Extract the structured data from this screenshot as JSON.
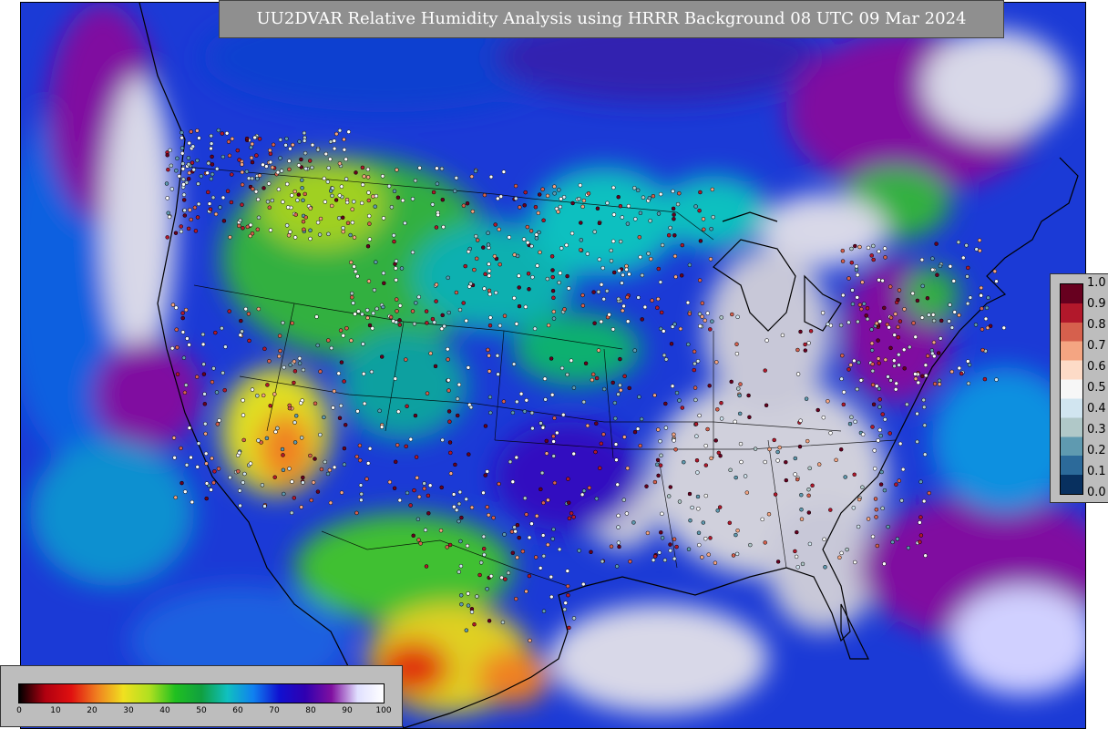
{
  "title": "UU2DVAR Relative Humidity Analysis using HRRR Background 08 UTC 09 Mar 2024",
  "rh_colorbar": {
    "ticks": [
      "0",
      "10",
      "20",
      "30",
      "40",
      "50",
      "60",
      "70",
      "80",
      "90",
      "100"
    ],
    "colors": [
      "#000000",
      "#b00010",
      "#e01010",
      "#f08020",
      "#f0e020",
      "#b0e020",
      "#20c020",
      "#10a040",
      "#10c0c0",
      "#1080f0",
      "#1010d0",
      "#3000b0",
      "#8010a0",
      "#e0e0ff",
      "#ffffff"
    ]
  },
  "obs_colorbar": {
    "ticks": [
      "1.0",
      "0.9",
      "0.8",
      "0.7",
      "0.6",
      "0.5",
      "0.4",
      "0.3",
      "0.2",
      "0.1",
      "0.0"
    ],
    "colors": [
      "#67001f",
      "#b2182b",
      "#d6604d",
      "#f4a582",
      "#fddbc7",
      "#f7f7f7",
      "#d1e5f0",
      "#b0c8c8",
      "#5f9ab0",
      "#2c6a9a",
      "#08305f"
    ]
  }
}
